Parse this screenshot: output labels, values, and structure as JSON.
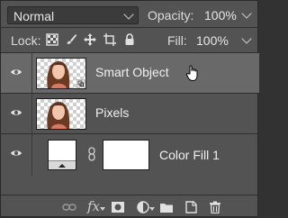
{
  "blend_mode": {
    "value": "Normal"
  },
  "opacity": {
    "label": "Opacity:",
    "value": "100%"
  },
  "lock": {
    "label": "Lock:"
  },
  "fill": {
    "label": "Fill:",
    "value": "100%"
  },
  "layers": [
    {
      "name": "Smart Object",
      "selected": true
    },
    {
      "name": "Pixels",
      "selected": false
    },
    {
      "name": "Color Fill 1",
      "selected": false
    }
  ],
  "toolbar_icons": [
    "link-icon",
    "fx-icon",
    "mask-icon",
    "adjustment-icon",
    "folder-icon",
    "new-layer-icon",
    "trash-icon"
  ],
  "colors": {
    "panel": "#535353",
    "selected_row": "#696969",
    "text": "#f0f0f0"
  }
}
